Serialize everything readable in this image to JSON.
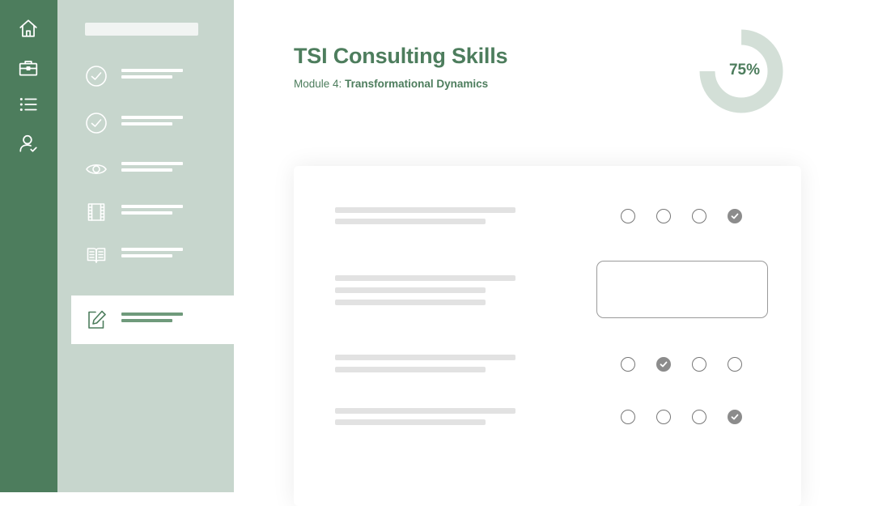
{
  "app": {
    "title": "TSI Consulting Skills",
    "module_prefix": "Module 4:",
    "module_name": "Transformational Dynamics"
  },
  "progress": {
    "label": "75%",
    "value": 0.75
  },
  "rail": {
    "icons": [
      "home-icon",
      "briefcase-icon",
      "list-icon",
      "user-check-icon"
    ]
  },
  "sidebar": {
    "items": [
      {
        "icon": "check-circle-icon",
        "label": ""
      },
      {
        "icon": "check-circle-icon",
        "label": ""
      },
      {
        "icon": "eye-icon",
        "label": ""
      },
      {
        "icon": "film-icon",
        "label": ""
      },
      {
        "icon": "book-icon",
        "label": ""
      },
      {
        "icon": "edit-icon",
        "label": "",
        "active": true
      }
    ]
  },
  "form": {
    "questions": [
      {
        "type": "radio",
        "options": 4,
        "selected_index": 3
      },
      {
        "type": "text",
        "value": ""
      },
      {
        "type": "radio",
        "options": 4,
        "selected_index": 1
      },
      {
        "type": "radio",
        "options": 4,
        "selected_index": 3
      }
    ]
  },
  "colors": {
    "brand_green": "#4d7d5d",
    "sidebar_bg": "#c7d6cd",
    "progress_track": "#d3dfd7"
  }
}
